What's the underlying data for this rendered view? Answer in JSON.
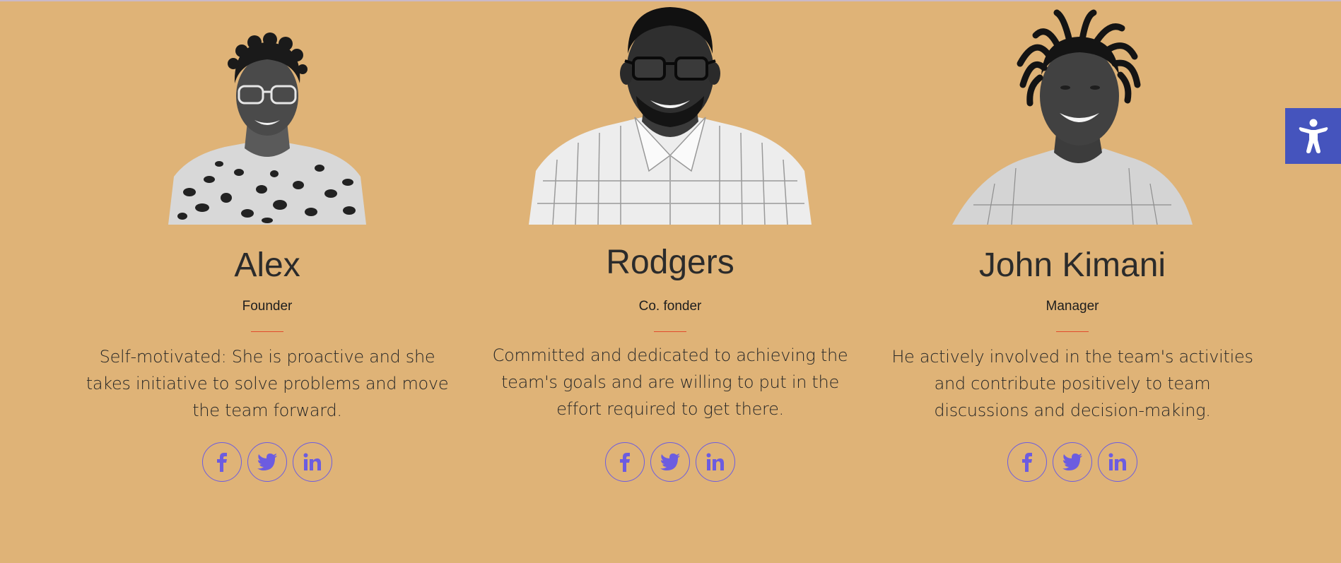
{
  "team": [
    {
      "name": "Alex",
      "role": "Founder",
      "bio_lines": [
        "Self-motivated: She is proactive and she",
        "takes initiative to solve problems and move",
        "the team forward."
      ],
      "photo_icon": "portrait-photo-alex"
    },
    {
      "name": "Rodgers",
      "role": "Co. fonder",
      "bio_lines": [
        "Committed and dedicated to achieving the",
        "team's goals and are willing to put in the",
        "effort required to get there."
      ],
      "photo_icon": "portrait-photo-rodgers"
    },
    {
      "name": "John Kimani",
      "role": "Manager",
      "bio_lines": [
        "He actively involved in the team's activities",
        "and contribute positively to team",
        "discussions and decision-making."
      ],
      "photo_icon": "portrait-photo-john"
    }
  ],
  "social_icons": [
    "facebook-icon",
    "twitter-icon",
    "linkedin-icon"
  ],
  "accessibility_icon": "accessibility-icon",
  "colors": {
    "background": "#dfb377",
    "divider": "#e24b2c",
    "social": "#6c5ce0",
    "accessibility_button": "#4554bd"
  }
}
